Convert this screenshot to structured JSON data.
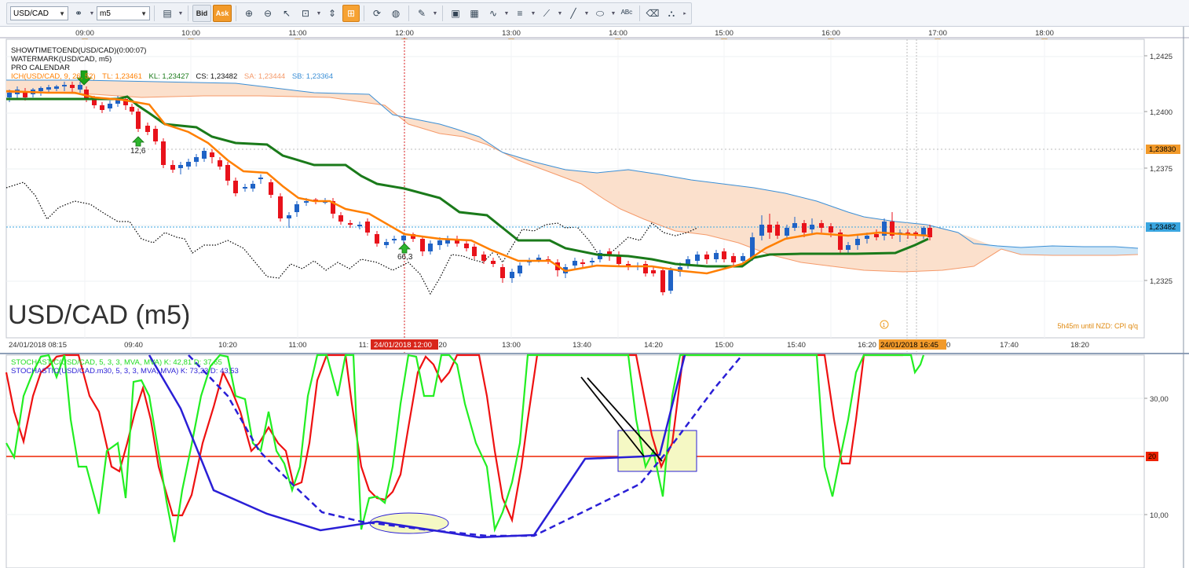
{
  "toolbar": {
    "symbol": "USD/CAD",
    "timeframe": "m5",
    "bid_label": "Bid",
    "ask_label": "Ask"
  },
  "top_time_labels": [
    "09:00",
    "10:00",
    "11:00",
    "12:00",
    "13:00",
    "14:00",
    "15:00",
    "16:00",
    "17:00",
    "18:00"
  ],
  "main_panel": {
    "legend": {
      "line1": "SHOWTIMETOEND(USD/CAD)(0:00:07)",
      "line2": "WATERMARK(USD/CAD, m5)",
      "line3": "PRO CALENDAR",
      "ich_prefix": "ICH(USD/CAD, 9, 26, 52)",
      "tl": "TL: 1,23461",
      "kl": "KL: 1,23427",
      "cs": "CS: 1,23482",
      "sa": "SA: 1,23444",
      "sb": "SB: 1,23364"
    },
    "watermark": "USD/CAD (m5)",
    "price_labels": [
      "1,2425",
      "1,2400",
      "1,2375",
      "1,2350",
      "1,2325"
    ],
    "current_price_box": "1,23482",
    "level_price_box": "1,23830",
    "arrow_labels": [
      "12,6",
      "66,3"
    ],
    "calendar_note": "5h45m until NZD: CPI q/q",
    "calendar_marker": "1",
    "colors": {
      "tenkan": "#ff7f00",
      "kijun": "#1a7a1a",
      "chikou": "#000000",
      "senkou_a": "#f59a6a",
      "senkou_b": "#3b8fd6",
      "cloud": "#fbe0cc",
      "cloud_blue": "#cfe6f6",
      "bull_candle": "#1f63c6",
      "bear_candle": "#e8121b"
    }
  },
  "bottom_time_axis": {
    "labels": [
      "24/01/2018 08:15",
      "09:40",
      "10:20",
      "11:00",
      "11:",
      "12:20",
      "13:00",
      "13:40",
      "14:20",
      "15:00",
      "15:40",
      "16:20",
      "17:40",
      "18:20"
    ],
    "highlight_left": "24/01/2018 12:00",
    "highlight_right": "24/01/2018 16:45",
    "tail_right": "0"
  },
  "stoch_panel": {
    "legend1": "STOCHASTIC(USD/CAD, 5, 3, 3, MVA, MVA)  K: 42,81  D: 37,65",
    "legend2": "STOCHASTIC(USD/CAD.m30, 5, 3, 3, MVA, MVA)  K: 73,23  D: 43,53",
    "price_labels": [
      "30,00",
      "10,00"
    ],
    "level_box": "20",
    "colors": {
      "k_m5": "#22ee22",
      "d_m5": "#ee1111",
      "k_m30": "#2a1fd6",
      "level": "#ee2200",
      "highlight": "#f5f8c4"
    }
  }
}
